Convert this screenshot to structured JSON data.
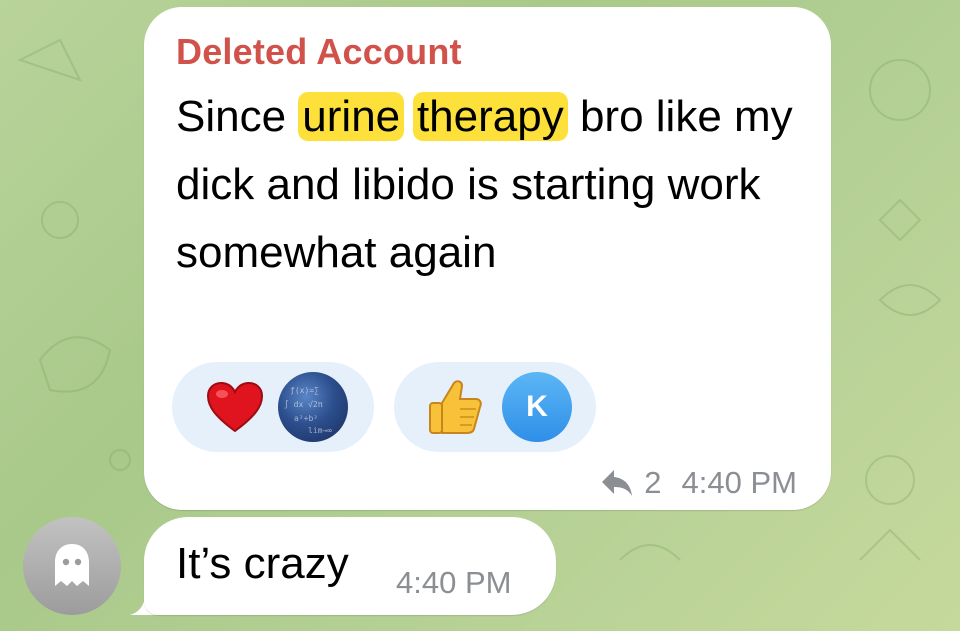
{
  "chat": {
    "message1": {
      "sender": "Deleted Account",
      "text_before": "Since ",
      "highlight1": "urine",
      "highlight2": "therapy",
      "text_after": " bro like my dick and libido is starting work somewhat again",
      "reactions": [
        {
          "emoji": "heart",
          "avatar": "math-avatar"
        },
        {
          "emoji": "thumbs-up",
          "avatar_letter": "K"
        }
      ],
      "reply_count": "2",
      "time": "4:40 PM"
    },
    "message2": {
      "text": "It’s crazy",
      "time": "4:40 PM"
    }
  },
  "colors": {
    "sender_name": "#d0524a",
    "highlight": "#fde13a",
    "reaction_bg": "#e6f0fb",
    "meta_text": "#8b8f93"
  }
}
